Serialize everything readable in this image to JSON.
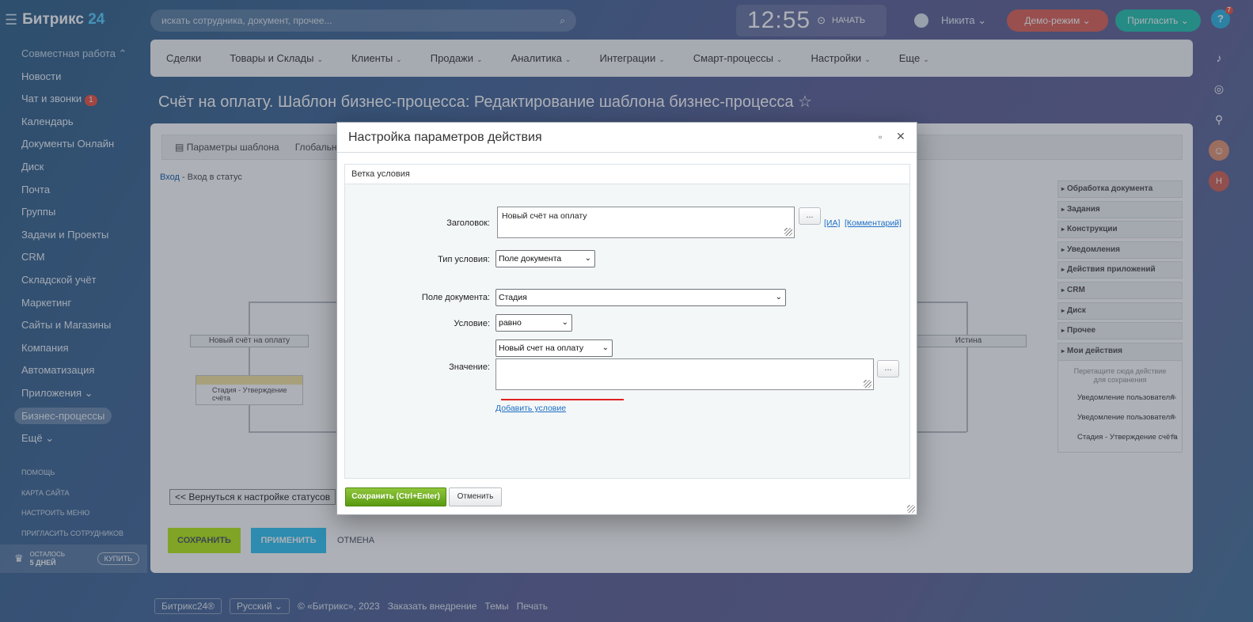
{
  "app": {
    "logo_name": "Битрикс",
    "logo_num": "24"
  },
  "sidebar": {
    "items": [
      {
        "label": "Совместная работа ⌃",
        "group": true
      },
      {
        "label": "Новости"
      },
      {
        "label": "Чат и звонки",
        "badge": "1"
      },
      {
        "label": "Календарь"
      },
      {
        "label": "Документы Онлайн"
      },
      {
        "label": "Диск"
      },
      {
        "label": "Почта"
      },
      {
        "label": "Группы"
      },
      {
        "label": "Задачи и Проекты"
      },
      {
        "label": "CRM"
      },
      {
        "label": "Складской учёт"
      },
      {
        "label": "Маркетинг"
      },
      {
        "label": "Сайты и Магазины"
      },
      {
        "label": "Компания"
      },
      {
        "label": "Автоматизация"
      },
      {
        "label": "Приложения ⌄"
      },
      {
        "label": "Бизнес-процессы",
        "active": true
      },
      {
        "label": "Ещё ⌄"
      }
    ],
    "small_links": [
      "Помощь",
      "Карта сайта",
      "Настроить меню",
      "Пригласить сотрудников"
    ],
    "trial_line1": "Осталось",
    "trial_line2": "5 дней",
    "buy": "Купить"
  },
  "header": {
    "search_placeholder": "искать сотрудника, документ, прочее...",
    "time": "12:55",
    "start": "НАЧАТЬ",
    "user": "Никита ⌄",
    "demo": "Демо-режим ⌄",
    "invite": "Пригласить ⌄",
    "help": "?",
    "help_badge": "7"
  },
  "topmenu": [
    "Сделки",
    "Товары и Склады",
    "Клиенты",
    "Продажи",
    "Аналитика",
    "Интеграции",
    "Смарт-процессы",
    "Настройки",
    "Еще"
  ],
  "page_title": "Счёт на оплату. Шаблон бизнес-процесса: Редактирование шаблона бизнес-процесса ☆",
  "designer": {
    "tab1": "Параметры шаблона",
    "tab2": "Глобальн",
    "crumb_link": "Вход",
    "crumb_rest": " - Вход в статус",
    "branch_left": "Новый счёт на оплату",
    "branch_right": "Истина",
    "activity": "Стадия - Утверждение счёта",
    "back": "<< Вернуться к настройке статусов",
    "save": "Сохранить",
    "apply": "Применить",
    "cancel": "Отмена"
  },
  "palette": {
    "groups": [
      "Обработка документа",
      "Задания",
      "Конструкции",
      "Уведомления",
      "Действия приложений",
      "CRM",
      "Диск",
      "Прочее"
    ],
    "my_actions": "Мои действия",
    "hint": "Перетащите сюда действие для сохранения",
    "actions": [
      "Уведомление пользователя",
      "Уведомление пользователя",
      "Стадия - Утверждение счёта"
    ]
  },
  "footer": {
    "brand": "Битрикс24®",
    "lang": "Русский ⌄",
    "copy": "© «Битрикс», 2023",
    "order": "Заказать внедрение",
    "themes": "Темы",
    "print": "Печать"
  },
  "dialog": {
    "title": "Настройка параметров действия",
    "section": "Ветка условия",
    "title_label": "Заголовок:",
    "title_value": "Новый счёт на оплату",
    "dots": "...",
    "ia": "[ИА]",
    "comment": "[Комментарий]",
    "cond_type_label": "Тип условия:",
    "cond_type_value": "Поле документа",
    "doc_field_label": "Поле документа:",
    "doc_field_value": "Стадия",
    "condition_label": "Условие:",
    "condition_value": "равно",
    "value_select": "Новый счет на оплату",
    "value_label": "Значение:",
    "add_condition": "Добавить условие",
    "save": "Сохранить (Ctrl+Enter)",
    "cancel": "Отменить"
  }
}
